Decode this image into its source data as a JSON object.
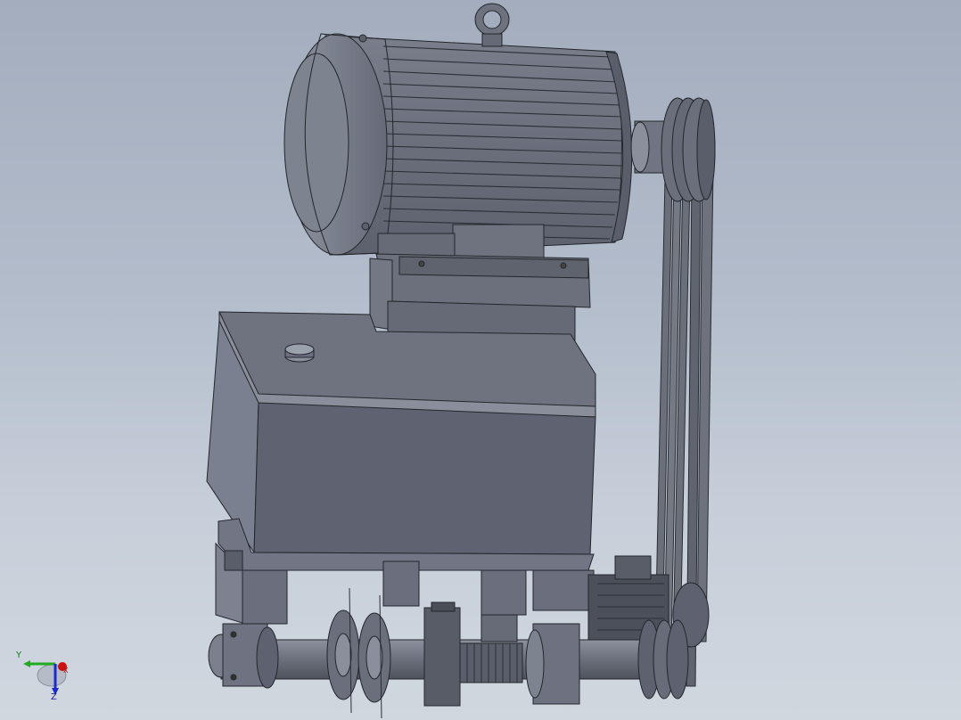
{
  "view": {
    "kind": "cad-3d-viewport",
    "background_gradient": [
      "#a3adbd",
      "#d0d7df"
    ],
    "model_color": "#6f7380",
    "model_dark": "#4a4e58",
    "model_light": "#8d929e"
  },
  "triad": {
    "x_label": "X",
    "y_label": "Y",
    "z_label": "Z",
    "x_color": "#cc1111",
    "y_color": "#22aa22",
    "z_color": "#1a2acc"
  },
  "model": {
    "icons": [
      "motor-icon",
      "eye-bolt-icon",
      "pulley-icon",
      "belt-icon",
      "gearbox-icon",
      "shaft-icon",
      "coupling-icon"
    ]
  }
}
